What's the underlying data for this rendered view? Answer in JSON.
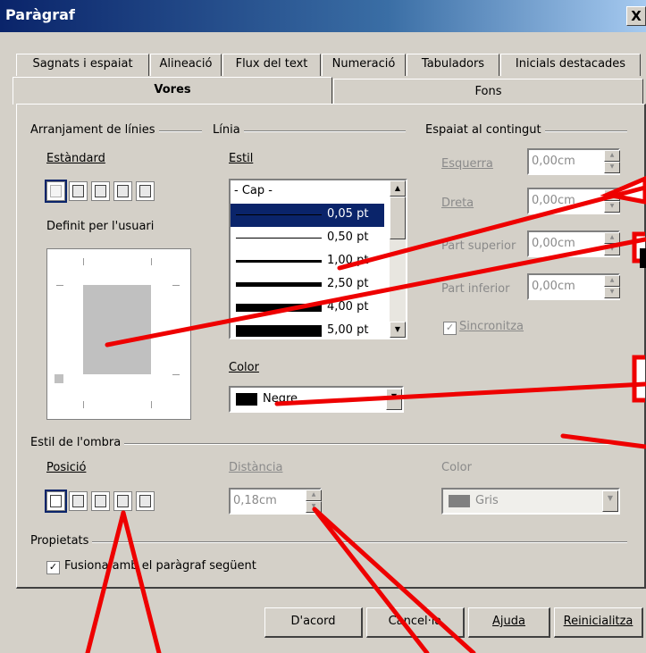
{
  "window": {
    "title": "Paràgraf",
    "close": "X"
  },
  "tabs_row1": [
    "Sagnats i espaiat",
    "Alineació",
    "Flux del text",
    "Numeració",
    "Tabuladors",
    "Inicials destacades"
  ],
  "tabs_row2": {
    "active": "Vores",
    "other": "Fons"
  },
  "arrangement": {
    "title": "Arranjament de línies",
    "standard_label": "Estàndard",
    "user_label": "Definit per l'usuari"
  },
  "line": {
    "title": "Línia",
    "style_label": "Estil",
    "styles": [
      "- Cap -",
      "0,05 pt",
      "0,50 pt",
      "1,00 pt",
      "2,50 pt",
      "4,00 pt",
      "5,00 pt"
    ],
    "selected_index": 1,
    "color_label": "Color",
    "color_value": "Negre",
    "color_hex": "#000000"
  },
  "spacing": {
    "title": "Espaiat al contingut",
    "left_label": "Esquerra",
    "left_value": "0,00cm",
    "right_label": "Dreta",
    "right_value": "0,00cm",
    "top_label": "Part superior",
    "top_value": "0,00cm",
    "bottom_label": "Part inferior",
    "bottom_value": "0,00cm",
    "sync_label": "Sincronitza"
  },
  "shadow": {
    "title": "Estil de l'ombra",
    "position_label": "Posició",
    "distance_label": "Distància",
    "distance_value": "0,18cm",
    "color_label": "Color",
    "color_value": "Gris",
    "color_hex": "#808080"
  },
  "properties": {
    "title": "Propietats",
    "merge_label": "Fusiona amb el paràgraf següent",
    "merge_checked": true
  },
  "buttons": {
    "ok": "D'acord",
    "cancel": "Cancel·la",
    "help": "Ajuda",
    "reset": "Reinicialitza"
  },
  "colors": {
    "annotation": "#ee0000",
    "titlebar": "#0a246a",
    "selection": "#0a246a"
  }
}
